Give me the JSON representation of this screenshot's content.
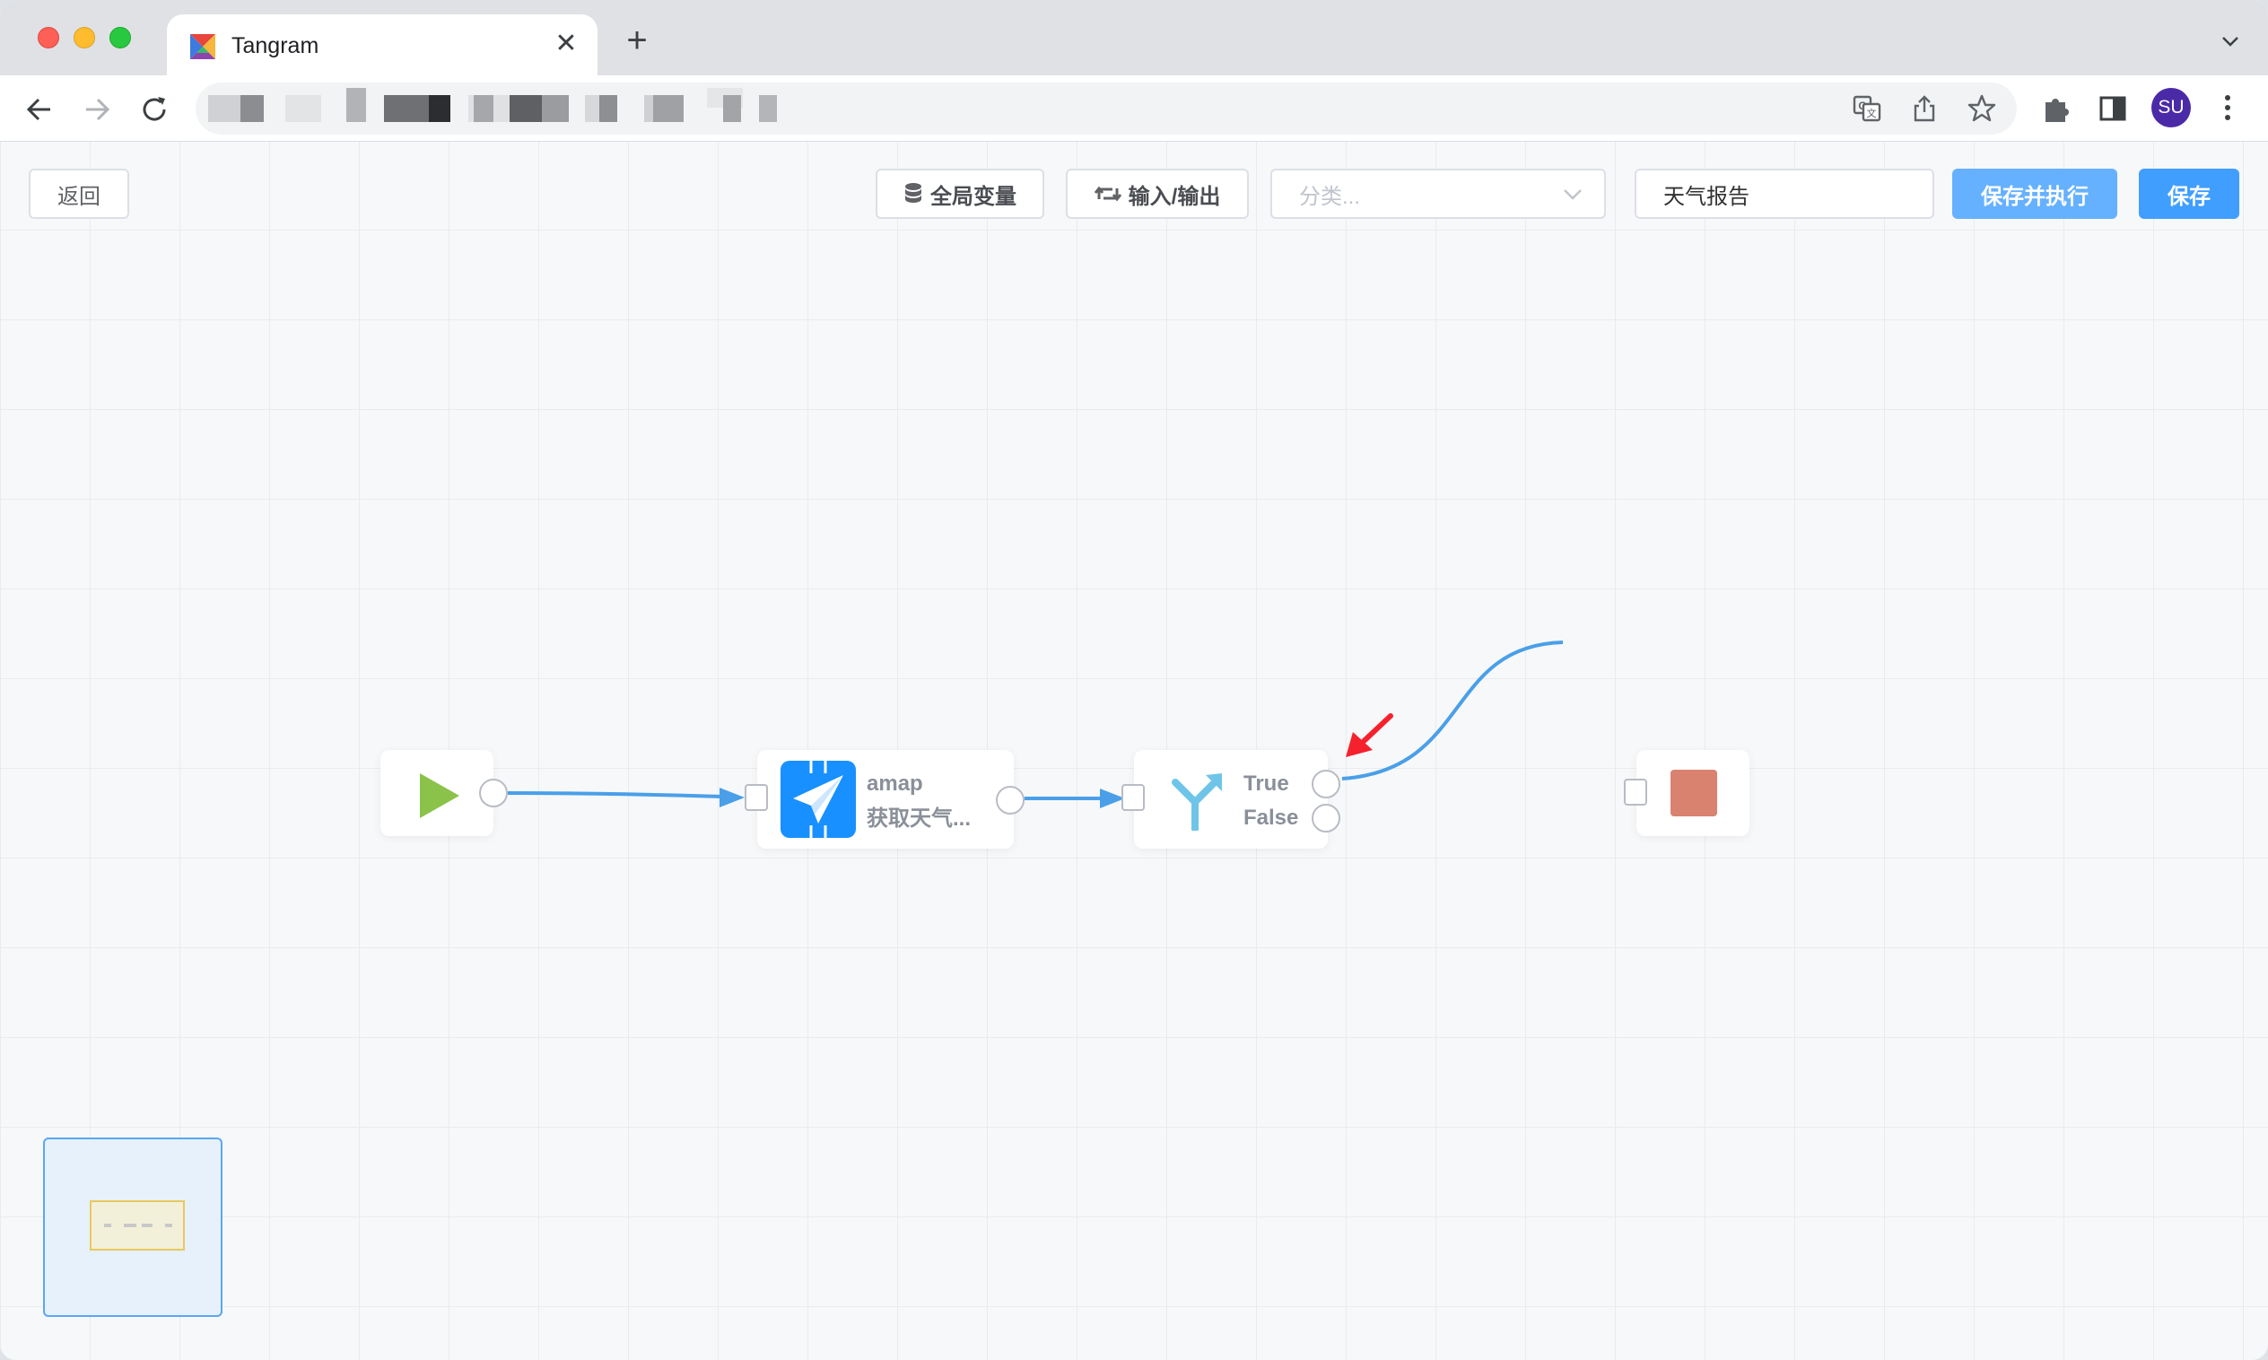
{
  "browser": {
    "tab_title": "Tangram",
    "tab_close": "✕",
    "new_tab": "+",
    "avatar_initials": "SU"
  },
  "toolbar": {
    "back_label": "返回",
    "global_vars_label": "全局变量",
    "io_label": "输入/输出",
    "category_placeholder": "分类...",
    "name_value": "天气报告",
    "save_run_label": "保存并执行",
    "save_label": "保存",
    "colors": {
      "save_run_bg": "#66b1ff",
      "save_bg": "#409eff"
    }
  },
  "canvas": {
    "nodes": {
      "start": {
        "icon": "play-icon",
        "color": "#8bc34a"
      },
      "amap": {
        "icon": "paper-plane-icon",
        "title": "amap",
        "subtitle": "获取天气...",
        "color": "#1890ff"
      },
      "condition": {
        "icon": "branch-icon",
        "true_label": "True",
        "false_label": "False",
        "color": "#6ec5e9"
      },
      "end": {
        "icon": "stop-icon",
        "color": "#d9826f"
      }
    },
    "edge_color": "#4a9fe8",
    "annotation_color": "#f5222d"
  }
}
